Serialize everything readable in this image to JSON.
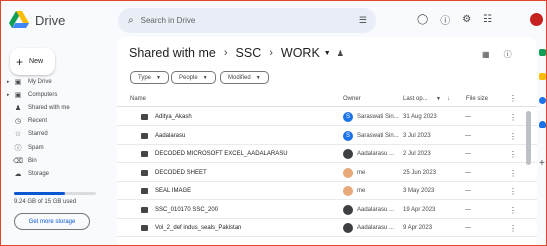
{
  "app": {
    "name": "Drive"
  },
  "search": {
    "placeholder": "Search in Drive"
  },
  "sidebar": {
    "new_label": "New",
    "items": [
      {
        "label": "My Drive",
        "icon": "drive-icon"
      },
      {
        "label": "Computers",
        "icon": "computer-icon"
      },
      {
        "label": "Shared with me",
        "icon": "people-icon"
      },
      {
        "label": "Recent",
        "icon": "clock-icon"
      },
      {
        "label": "Starred",
        "icon": "star-icon"
      },
      {
        "label": "Spam",
        "icon": "spam-icon"
      },
      {
        "label": "Bin",
        "icon": "trash-icon"
      },
      {
        "label": "Storage",
        "icon": "cloud-icon"
      }
    ],
    "storage": {
      "text": "9.24 GB of 15 GB used",
      "fraction": 0.62,
      "button_label": "Get more storage"
    }
  },
  "breadcrumb": [
    "Shared with me",
    "SSC",
    "WORK"
  ],
  "filters": [
    "Type",
    "People",
    "Modified"
  ],
  "table": {
    "columns": {
      "name": "Name",
      "owner": "Owner",
      "modified": "Last op...",
      "size": "File size"
    },
    "rows": [
      {
        "name": "Aditya_Akash",
        "owner": "Saraswati Sin...",
        "date": "31 Aug 2023",
        "size": "—",
        "avatar": "S",
        "color": "#1a73e8"
      },
      {
        "name": "Aadalarasu",
        "owner": "Saraswati Sin...",
        "date": "3 Jul 2023",
        "size": "—",
        "avatar": "S",
        "color": "#1a73e8"
      },
      {
        "name": "DECODED MICROSOFT EXCEL_AADALARASU",
        "owner": "Aadalarasu ...",
        "date": "2 Jul 2023",
        "size": "—",
        "avatar": "",
        "color": "#3c4043"
      },
      {
        "name": "DECODED SHEET",
        "owner": "me",
        "date": "25 Jun 2023",
        "size": "—",
        "avatar": "",
        "color": "#e8a97b"
      },
      {
        "name": "SEAL IMAGE",
        "owner": "me",
        "date": "3 May 2023",
        "size": "—",
        "avatar": "",
        "color": "#e8a97b"
      },
      {
        "name": "SSC_010170 SSC_200",
        "owner": "Aadalarasu ...",
        "date": "19 Apr 2023",
        "size": "—",
        "avatar": "",
        "color": "#3c4043"
      },
      {
        "name": "Vol_2_def indus_seals_Pakistan",
        "owner": "Aadalarasu ...",
        "date": "9 Apr 2023",
        "size": "—",
        "avatar": "",
        "color": "#3c4043"
      }
    ]
  },
  "colors": {
    "accent": "#0b57d0",
    "background": "#f8fafd"
  }
}
